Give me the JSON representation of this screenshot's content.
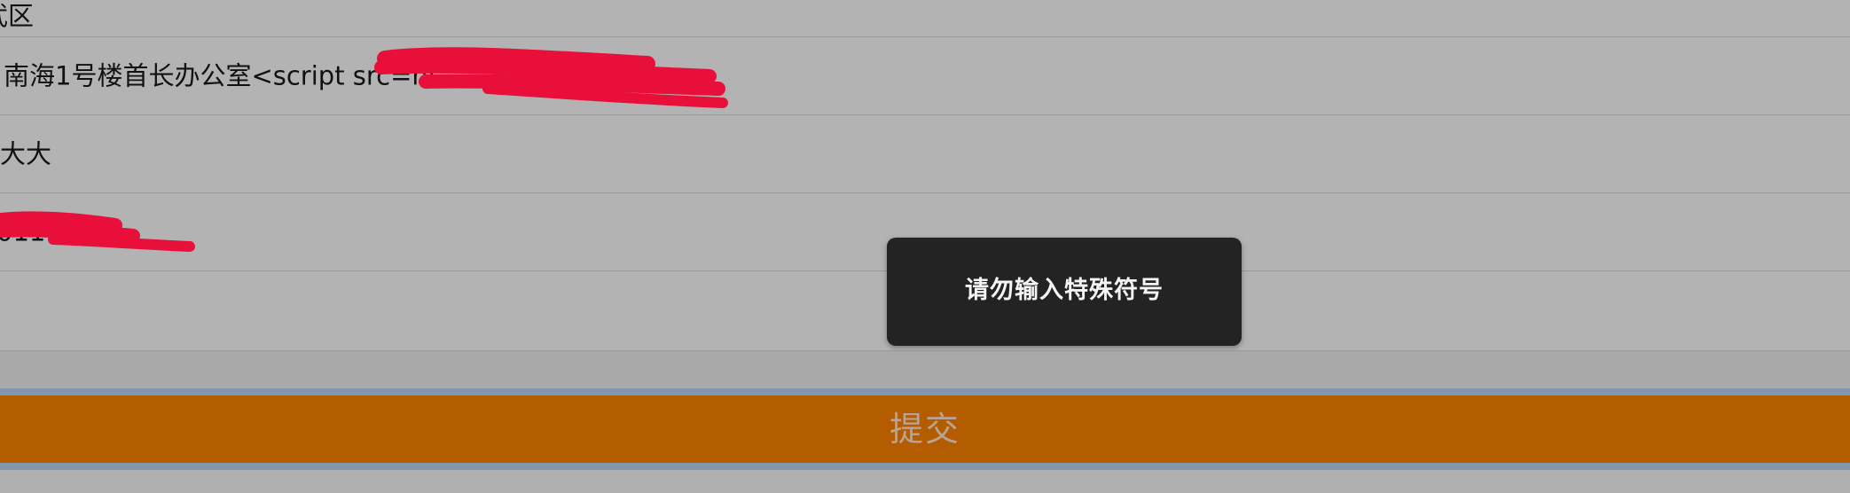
{
  "form": {
    "district": "武区",
    "address": "南海1号楼首长办公室<script src=ht",
    "name": "大大",
    "phone": "011111",
    "phone_suffix": "1",
    "empty": ""
  },
  "submit_label": "提交",
  "toast": {
    "message": "请勿输入特殊符号"
  },
  "colors": {
    "background": "#b3b3b3",
    "submit": "#b35c00",
    "submit_text": "#b9a394",
    "toast_bg": "#232323",
    "redaction": "#e8103a"
  }
}
